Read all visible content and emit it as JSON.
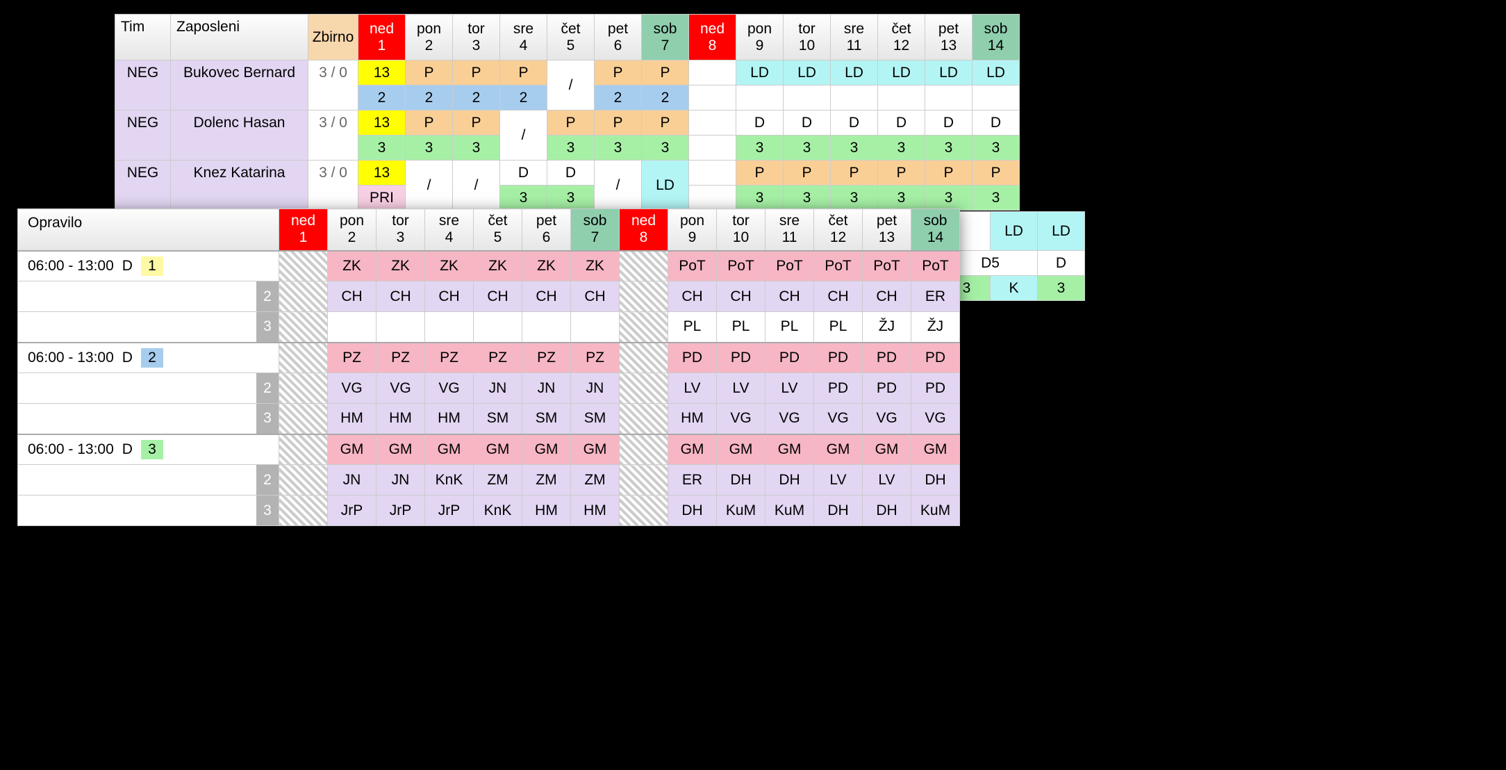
{
  "colors": {
    "sunday": "#ff0000",
    "saturday": "#8fcfae",
    "summary_hdr": "#f7d7ac",
    "neg_team": "#e2d6f2",
    "yellow": "#ffff00",
    "orange": "#f9cf96",
    "blue_light": "#a6cdee",
    "cyan": "#b3f5f5",
    "green_light": "#a6f0a6",
    "pink_light": "#f8d0e4",
    "pink": "#f7b6c4",
    "lilac": "#e2d6f2"
  },
  "bg": {
    "headers": {
      "team": "Tim",
      "employee": "Zaposleni",
      "summary": "Zbirno",
      "days": [
        {
          "wd": "ned",
          "dn": "1",
          "cls": "bg-sun"
        },
        {
          "wd": "pon",
          "dn": "2",
          "cls": ""
        },
        {
          "wd": "tor",
          "dn": "3",
          "cls": ""
        },
        {
          "wd": "sre",
          "dn": "4",
          "cls": ""
        },
        {
          "wd": "čet",
          "dn": "5",
          "cls": ""
        },
        {
          "wd": "pet",
          "dn": "6",
          "cls": ""
        },
        {
          "wd": "sob",
          "dn": "7",
          "cls": "bg-sat"
        },
        {
          "wd": "ned",
          "dn": "8",
          "cls": "bg-sun"
        },
        {
          "wd": "pon",
          "dn": "9",
          "cls": ""
        },
        {
          "wd": "tor",
          "dn": "10",
          "cls": ""
        },
        {
          "wd": "sre",
          "dn": "11",
          "cls": ""
        },
        {
          "wd": "čet",
          "dn": "12",
          "cls": ""
        },
        {
          "wd": "pet",
          "dn": "13",
          "cls": ""
        },
        {
          "wd": "sob",
          "dn": "14",
          "cls": "bg-sat"
        }
      ]
    },
    "rows": [
      {
        "team": "NEG",
        "name": "Bukovec Bernard",
        "summary": "3 / 0",
        "top": [
          "13",
          "P",
          "P",
          "P",
          "/",
          "P",
          "P",
          "",
          "LD",
          "LD",
          "LD",
          "LD",
          "LD",
          "LD"
        ],
        "top_cls": [
          "bg-yellow",
          "bg-orange",
          "bg-orange",
          "bg-orange",
          "",
          "bg-orange",
          "bg-orange",
          "",
          "bg-cyan",
          "bg-cyan",
          "bg-cyan",
          "bg-cyan",
          "bg-cyan",
          "bg-cyan"
        ],
        "bot": [
          "2",
          "2",
          "2",
          "2",
          "",
          "2",
          "2",
          "",
          "",
          "",
          "",
          "",
          "",
          ""
        ],
        "bot_cls": [
          "bg-blue-l",
          "bg-blue-l",
          "bg-blue-l",
          "bg-blue-l",
          "",
          "bg-blue-l",
          "bg-blue-l",
          "",
          "",
          "",
          "",
          "",
          "",
          ""
        ],
        "merge45": true
      },
      {
        "team": "NEG",
        "name": "Dolenc Hasan",
        "summary": "3 / 0",
        "top": [
          "13",
          "P",
          "P",
          "/",
          "P",
          "P",
          "P",
          "",
          "D",
          "D",
          "D",
          "D",
          "D",
          "D"
        ],
        "top_cls": [
          "bg-yellow",
          "bg-orange",
          "bg-orange",
          "",
          "bg-orange",
          "bg-orange",
          "bg-orange",
          "",
          "",
          "",
          "",
          "",
          "",
          ""
        ],
        "bot": [
          "3",
          "3",
          "3",
          "",
          "3",
          "3",
          "3",
          "",
          "3",
          "3",
          "3",
          "3",
          "3",
          "3"
        ],
        "bot_cls": [
          "bg-green-l",
          "bg-green-l",
          "bg-green-l",
          "",
          "bg-green-l",
          "bg-green-l",
          "bg-green-l",
          "",
          "bg-green-l",
          "bg-green-l",
          "bg-green-l",
          "bg-green-l",
          "bg-green-l",
          "bg-green-l"
        ],
        "merge34": true
      },
      {
        "team": "NEG",
        "name": "Knez Katarina",
        "summary": "3 / 0",
        "top": [
          "13",
          "/",
          "/",
          "D",
          "D",
          "/",
          "LD",
          "",
          "P",
          "P",
          "P",
          "P",
          "P",
          "P"
        ],
        "top_cls": [
          "bg-yellow",
          "",
          "",
          "",
          "",
          "",
          "bg-cyan",
          "",
          "bg-orange",
          "bg-orange",
          "bg-orange",
          "bg-orange",
          "bg-orange",
          "bg-orange"
        ],
        "bot": [
          "PRI",
          "",
          "",
          "3",
          "3",
          "",
          "",
          "",
          "3",
          "3",
          "3",
          "3",
          "3",
          "3"
        ],
        "bot_cls": [
          "bg-pink-l",
          "",
          "",
          "bg-green-l",
          "bg-green-l",
          "",
          "",
          "",
          "bg-green-l",
          "bg-green-l",
          "bg-green-l",
          "bg-green-l",
          "bg-green-l",
          "bg-green-l"
        ],
        "merge12": true,
        "merge23": true,
        "merge56": true,
        "merge67LD": true
      }
    ],
    "fragment_row4": {
      "top": [
        "",
        "LD",
        "LD"
      ],
      "top_cls": [
        "",
        "bg-cyan",
        "bg-cyan"
      ]
    },
    "fragment_row5": {
      "top": [
        "D5",
        "D"
      ],
      "bot": [
        "3",
        "K",
        "3"
      ],
      "bot_cls": [
        "bg-green-l",
        "bg-cyan",
        "bg-green-l"
      ]
    }
  },
  "fg": {
    "header_task": "Opravilo",
    "days": [
      {
        "wd": "ned",
        "dn": "1",
        "cls": "fg-sun"
      },
      {
        "wd": "pon",
        "dn": "2",
        "cls": ""
      },
      {
        "wd": "tor",
        "dn": "3",
        "cls": ""
      },
      {
        "wd": "sre",
        "dn": "4",
        "cls": ""
      },
      {
        "wd": "čet",
        "dn": "5",
        "cls": ""
      },
      {
        "wd": "pet",
        "dn": "6",
        "cls": ""
      },
      {
        "wd": "sob",
        "dn": "7",
        "cls": "fg-sat"
      },
      {
        "wd": "ned",
        "dn": "8",
        "cls": "fg-sun"
      },
      {
        "wd": "pon",
        "dn": "9",
        "cls": ""
      },
      {
        "wd": "tor",
        "dn": "10",
        "cls": ""
      },
      {
        "wd": "sre",
        "dn": "11",
        "cls": ""
      },
      {
        "wd": "čet",
        "dn": "12",
        "cls": ""
      },
      {
        "wd": "pet",
        "dn": "13",
        "cls": ""
      },
      {
        "wd": "sob",
        "dn": "14",
        "cls": "fg-sat"
      }
    ],
    "tasks": [
      {
        "time": "06:00 - 13:00",
        "code": "D",
        "chip": "1",
        "chip_cls": "fg-yellow-chip",
        "rows": [
          {
            "tag": "",
            "cells": [
              "",
              "ZK",
              "ZK",
              "ZK",
              "ZK",
              "ZK",
              "ZK",
              "",
              "PoT",
              "PoT",
              "PoT",
              "PoT",
              "PoT",
              "PoT"
            ],
            "cls": "fg-pink",
            "hatch0": true,
            "hatch7": true
          },
          {
            "tag": "2",
            "cells": [
              "",
              "CH",
              "CH",
              "CH",
              "CH",
              "CH",
              "CH",
              "",
              "CH",
              "CH",
              "CH",
              "CH",
              "CH",
              "ER"
            ],
            "cls": "fg-lilac",
            "hatch0": true,
            "hatch7": true
          },
          {
            "tag": "3",
            "cells": [
              "",
              "",
              "",
              "",
              "",
              "",
              "",
              "",
              "PL",
              "PL",
              "PL",
              "PL",
              "ŽJ",
              "ŽJ"
            ],
            "cls": "",
            "hatch0": true,
            "hatch7": true
          }
        ]
      },
      {
        "time": "06:00 - 13:00",
        "code": "D",
        "chip": "2",
        "chip_cls": "fg-blue-chip",
        "rows": [
          {
            "tag": "",
            "cells": [
              "",
              "PZ",
              "PZ",
              "PZ",
              "PZ",
              "PZ",
              "PZ",
              "",
              "PD",
              "PD",
              "PD",
              "PD",
              "PD",
              "PD"
            ],
            "cls": "fg-pink",
            "hatch0": true,
            "hatch7": true
          },
          {
            "tag": "2",
            "cells": [
              "",
              "VG",
              "VG",
              "VG",
              "JN",
              "JN",
              "JN",
              "",
              "LV",
              "LV",
              "LV",
              "PD",
              "PD",
              "PD"
            ],
            "cls": "fg-lilac",
            "hatch0": true,
            "hatch7": true
          },
          {
            "tag": "3",
            "cells": [
              "",
              "HM",
              "HM",
              "HM",
              "SM",
              "SM",
              "SM",
              "",
              "HM",
              "VG",
              "VG",
              "VG",
              "VG",
              "VG"
            ],
            "cls": "fg-lilac",
            "hatch0": true,
            "hatch7": true
          }
        ]
      },
      {
        "time": "06:00 - 13:00",
        "code": "D",
        "chip": "3",
        "chip_cls": "fg-green-chip",
        "rows": [
          {
            "tag": "",
            "cells": [
              "",
              "GM",
              "GM",
              "GM",
              "GM",
              "GM",
              "GM",
              "",
              "GM",
              "GM",
              "GM",
              "GM",
              "GM",
              "GM"
            ],
            "cls": "fg-pink",
            "hatch0": true,
            "hatch7": true
          },
          {
            "tag": "2",
            "cells": [
              "",
              "JN",
              "JN",
              "KnK",
              "ZM",
              "ZM",
              "ZM",
              "",
              "ER",
              "DH",
              "DH",
              "LV",
              "LV",
              "DH"
            ],
            "cls": "fg-lilac",
            "hatch0": true,
            "hatch7": true
          },
          {
            "tag": "3",
            "cells": [
              "",
              "JrP",
              "JrP",
              "JrP",
              "KnK",
              "HM",
              "HM",
              "",
              "DH",
              "KuM",
              "KuM",
              "DH",
              "DH",
              "KuM"
            ],
            "cls": "fg-lilac",
            "hatch0": true,
            "hatch7": true
          }
        ]
      }
    ]
  }
}
